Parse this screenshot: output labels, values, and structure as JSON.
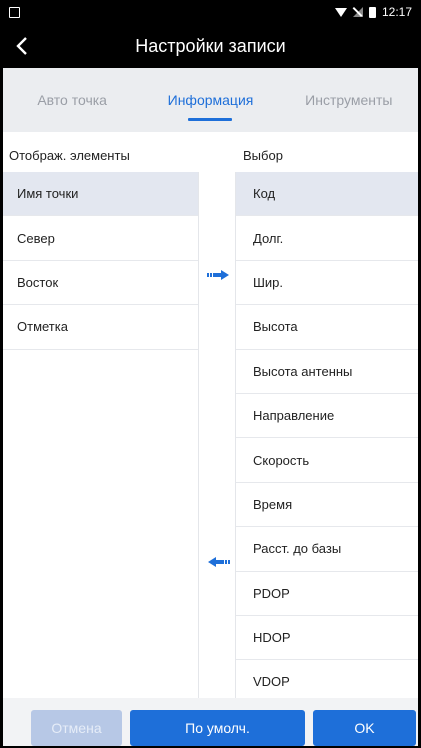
{
  "status_bar": {
    "time": "12:17"
  },
  "title_bar": {
    "title": "Настройки записи"
  },
  "tabs": [
    {
      "label": "Авто точка",
      "active": false
    },
    {
      "label": "Информация",
      "active": true
    },
    {
      "label": "Инструменты",
      "active": false
    }
  ],
  "columns": {
    "left_header": "Отображ. элементы",
    "right_header": "Выбор"
  },
  "left_items": [
    {
      "label": "Имя точки",
      "selected": true
    },
    {
      "label": "Север",
      "selected": false
    },
    {
      "label": "Восток",
      "selected": false
    },
    {
      "label": "Отметка",
      "selected": false
    }
  ],
  "right_items": [
    {
      "label": "Код",
      "selected": true
    },
    {
      "label": "Долг.",
      "selected": false
    },
    {
      "label": "Шир.",
      "selected": false
    },
    {
      "label": "Высота",
      "selected": false
    },
    {
      "label": "Высота антенны",
      "selected": false
    },
    {
      "label": "Направление",
      "selected": false
    },
    {
      "label": "Скорость",
      "selected": false
    },
    {
      "label": "Время",
      "selected": false
    },
    {
      "label": "Расст. до базы",
      "selected": false
    },
    {
      "label": "PDOP",
      "selected": false
    },
    {
      "label": "HDOP",
      "selected": false
    },
    {
      "label": "VDOP",
      "selected": false
    }
  ],
  "buttons": {
    "cancel": "Отмена",
    "default": "По умолч.",
    "ok": "OK"
  },
  "colors": {
    "accent": "#1e6fd9",
    "disabled": "#b7c8e6",
    "selected_row": "#e3e7f0"
  },
  "icons": {
    "back": "chevron-left-icon",
    "move_right": "arrow-right-icon",
    "move_left": "arrow-left-icon"
  }
}
